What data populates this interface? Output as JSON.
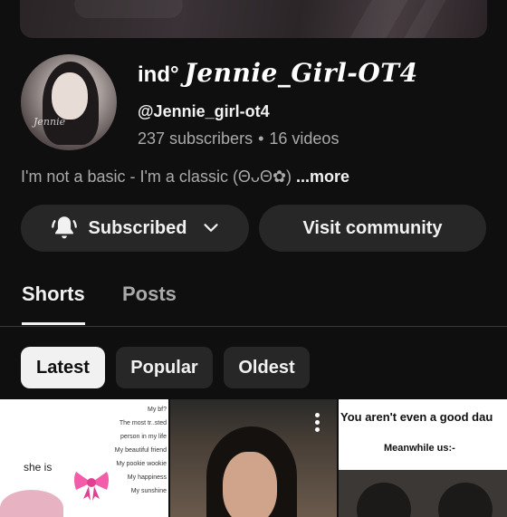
{
  "channel": {
    "name_prefix": "ind°",
    "name_fancy": "Jennie_Girl-OT4",
    "handle": "@Jennie_girl-ot4",
    "subscribers": "237 subscribers",
    "videos": "16 videos",
    "description": "I'm not a basic - I'm a classic (ΘᴗΘ✿)",
    "more_label": "...more",
    "avatar_signature": "Jennie"
  },
  "actions": {
    "subscribed_label": "Subscribed",
    "community_label": "Visit community"
  },
  "tabs": [
    {
      "label": "Shorts",
      "active": true
    },
    {
      "label": "Posts",
      "active": false
    }
  ],
  "filters": [
    {
      "label": "Latest",
      "active": true
    },
    {
      "label": "Popular",
      "active": false
    },
    {
      "label": "Oldest",
      "active": false
    }
  ],
  "shorts": [
    {
      "list_text": [
        "My bf?",
        "The most tr..sted",
        "person in my life",
        "My beautiful friend",
        "My pookie wookie",
        "My happiness",
        "My sunshine"
      ],
      "caption": "she is"
    },
    {
      "caption": ""
    },
    {
      "caption": "You aren't even a good dau",
      "subcaption": "Meanwhile us:-"
    }
  ],
  "colors": {
    "background": "#0f0f0f",
    "button_bg": "#272727",
    "text_primary": "#f1f1f1",
    "text_secondary": "#aaaaaa"
  },
  "icons": [
    "bell-icon",
    "chevron-down-icon",
    "more-vert-icon",
    "bow-icon"
  ]
}
